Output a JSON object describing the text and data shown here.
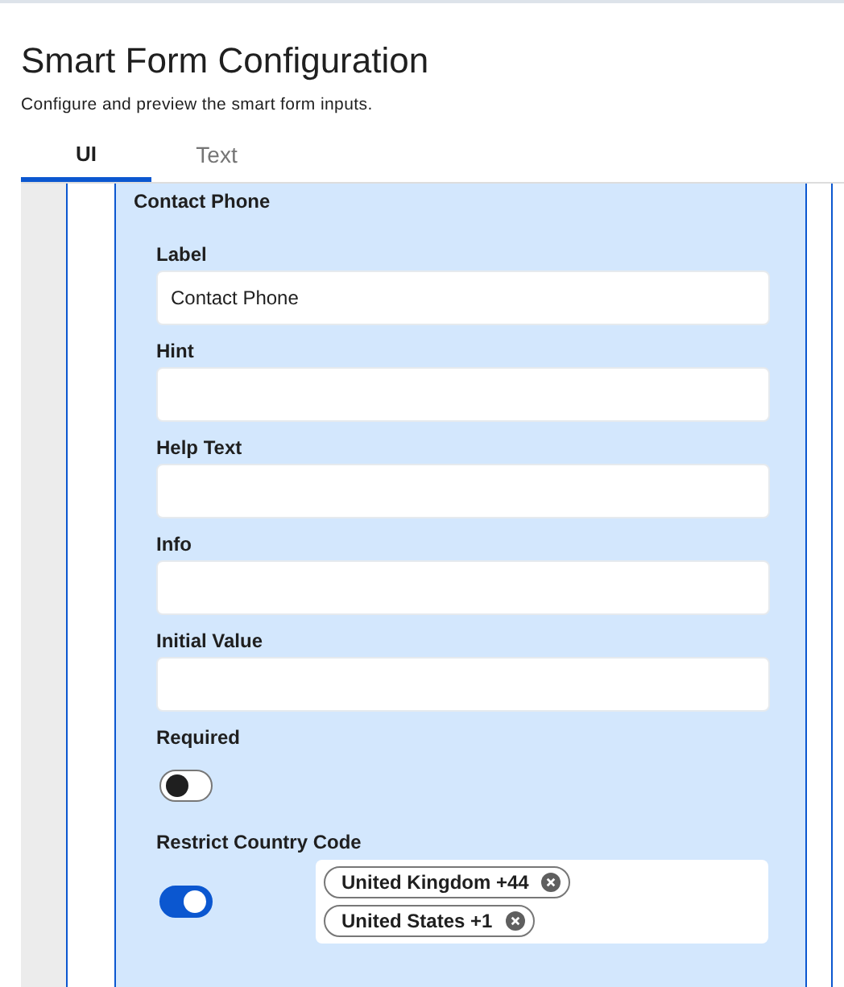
{
  "title": "Smart Form Configuration",
  "subtitle": "Configure and preview the smart form inputs.",
  "tabs": [
    {
      "label": "UI",
      "selected": true
    },
    {
      "label": "Text",
      "selected": false
    }
  ],
  "panel": {
    "title": "Contact Phone",
    "fields": [
      {
        "kind": "text",
        "label": "Label",
        "value": "Contact Phone"
      },
      {
        "kind": "text",
        "label": "Hint"
      },
      {
        "kind": "text",
        "label": "Help Text"
      },
      {
        "kind": "text",
        "label": "Info"
      },
      {
        "kind": "text",
        "label": "Initial Value"
      },
      {
        "kind": "toggle",
        "label": "Required",
        "on": false
      },
      {
        "kind": "toggle-chips",
        "label": "Restrict Country Code",
        "on": true,
        "chips": [
          "United Kingdom +44",
          "United States +1"
        ]
      }
    ]
  }
}
